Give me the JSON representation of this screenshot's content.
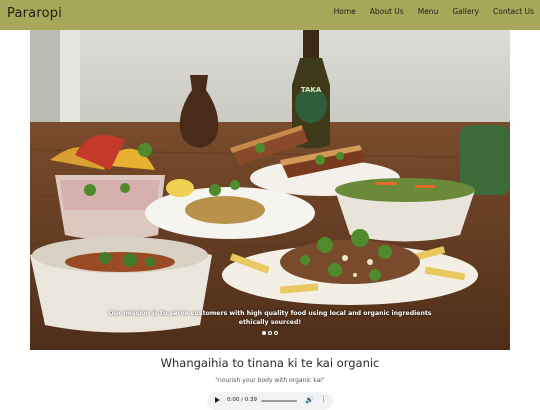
{
  "brand": "Pararopi",
  "nav": [
    "Home",
    "About Us",
    "Menu",
    "Gallery",
    "Contact Us"
  ],
  "hero": {
    "bottle_label": "TAKA",
    "caption_line1": "Our mission is to serve customers with high quality food using local and organic ingredients",
    "caption_line2": "ethically sourced!",
    "slides": 3,
    "active_slide": 1
  },
  "headline": "Whangaihia to tinana ki te kai organic",
  "subline": "\"nourish your body with organic kai\"",
  "audio": {
    "time": "0:00 / 0:39",
    "play_icon": "play-icon",
    "volume_icon": "volume-icon",
    "more_icon": "more-options-icon"
  }
}
